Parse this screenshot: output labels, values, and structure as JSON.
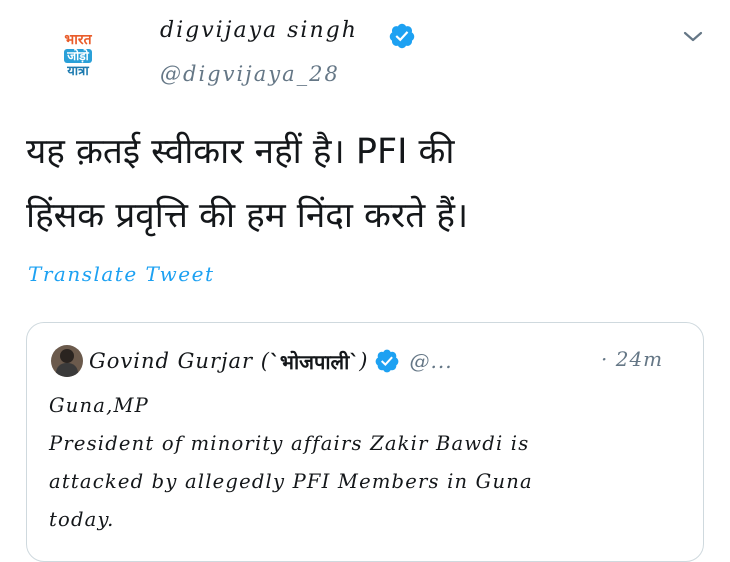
{
  "author": {
    "display_name": "digvijaya singh",
    "handle": "@digvijaya_28",
    "avatar_text": [
      "भारत",
      "जोड़ो",
      "यात्रा"
    ]
  },
  "tweet": {
    "text": "यह क़तई स्वीकार नहीं है। PFI की\nहिंसक प्रवृत्ति की हम निंदा करते हैं।",
    "translate_label": "Translate Tweet"
  },
  "quoted_tweet": {
    "author_name": "Govind Gurjar (",
    "author_name_hindi": "`भोजपाली`",
    "author_name_close": ")",
    "handle": "@...",
    "time": "· 24m",
    "text": "Guna,MP\nPresident of minority affairs Zakir Bawdi is\nattacked by allegedly PFI Members in Guna\ntoday."
  },
  "icons": {
    "verified": "verified-badge-icon",
    "caret": "chevron-down-icon"
  },
  "colors": {
    "accent": "#1da1f2",
    "secondary_text": "#657786",
    "border": "#cfd9de"
  }
}
